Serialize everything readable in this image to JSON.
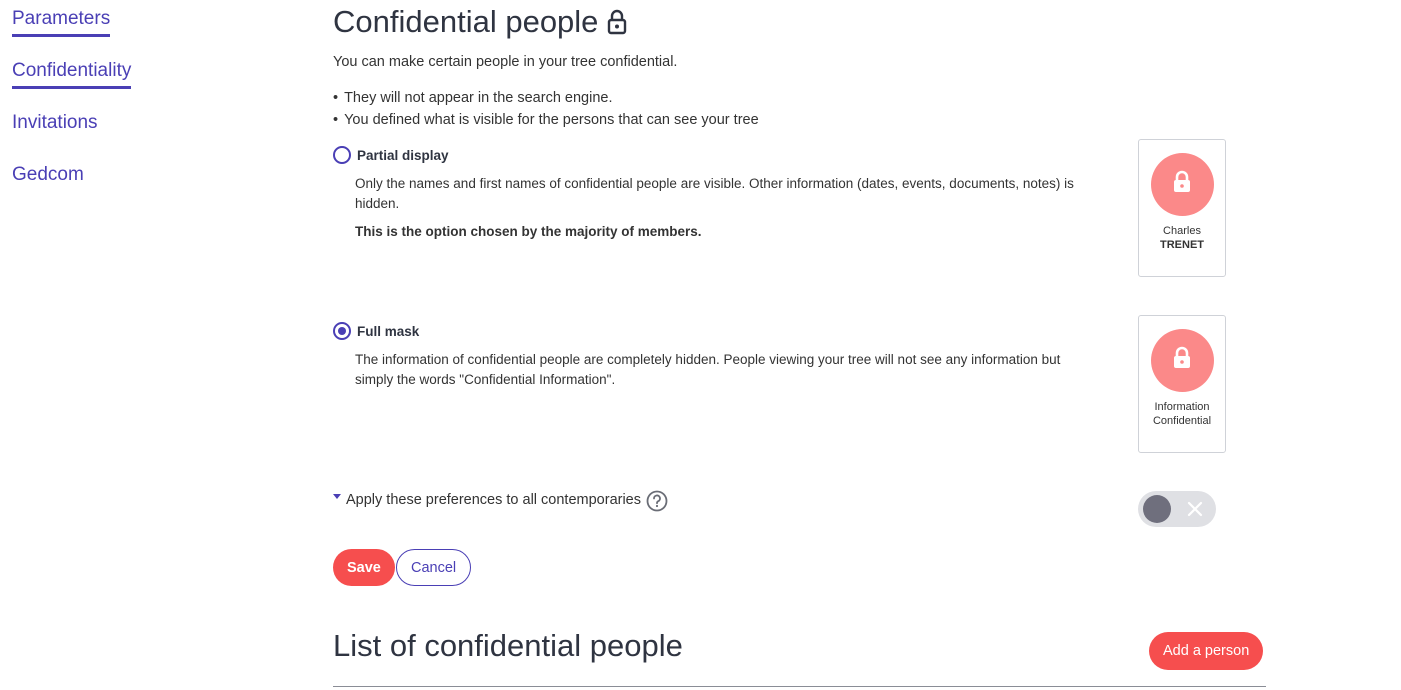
{
  "sidebar": {
    "items": [
      {
        "label": "Parameters",
        "active": true
      },
      {
        "label": "Confidentiality",
        "active": true
      },
      {
        "label": "Invitations",
        "active": false
      },
      {
        "label": "Gedcom",
        "active": false
      }
    ]
  },
  "header": {
    "title": "Confidential people",
    "title_icon": "lock-icon"
  },
  "intro": {
    "text": "You can make certain people in your tree confidential.",
    "bullets": [
      "They will not appear in the search engine.",
      "You defined what is visible for the persons that can see your tree"
    ]
  },
  "options": {
    "partial": {
      "label": "Partial display",
      "selected": false,
      "description": "Only the names and first names of confidential people are visible. Other information (dates, events, documents, notes) is hidden.",
      "note": "This is the option chosen by the majority of members.",
      "preview": {
        "line1": "Charles",
        "line2": "TRENET"
      }
    },
    "full": {
      "label": "Full mask",
      "selected": true,
      "description": "The information of confidential people are completely hidden. People viewing your tree will not see any information but simply the words \"Confidential Information\".",
      "preview": {
        "line1": "Information",
        "line2": "Confidential"
      }
    }
  },
  "apply": {
    "label": "Apply these preferences to all contemporaries",
    "enabled": false
  },
  "actions": {
    "save": "Save",
    "cancel": "Cancel"
  },
  "list": {
    "title": "List of confidential people",
    "add_button": "Add a person"
  },
  "colors": {
    "accent": "#4a3fb5",
    "primary_button": "#f64e4e",
    "avatar": "#fb8989",
    "toggle_track": "#dfe0e4",
    "toggle_knob": "#6f6f7d"
  }
}
